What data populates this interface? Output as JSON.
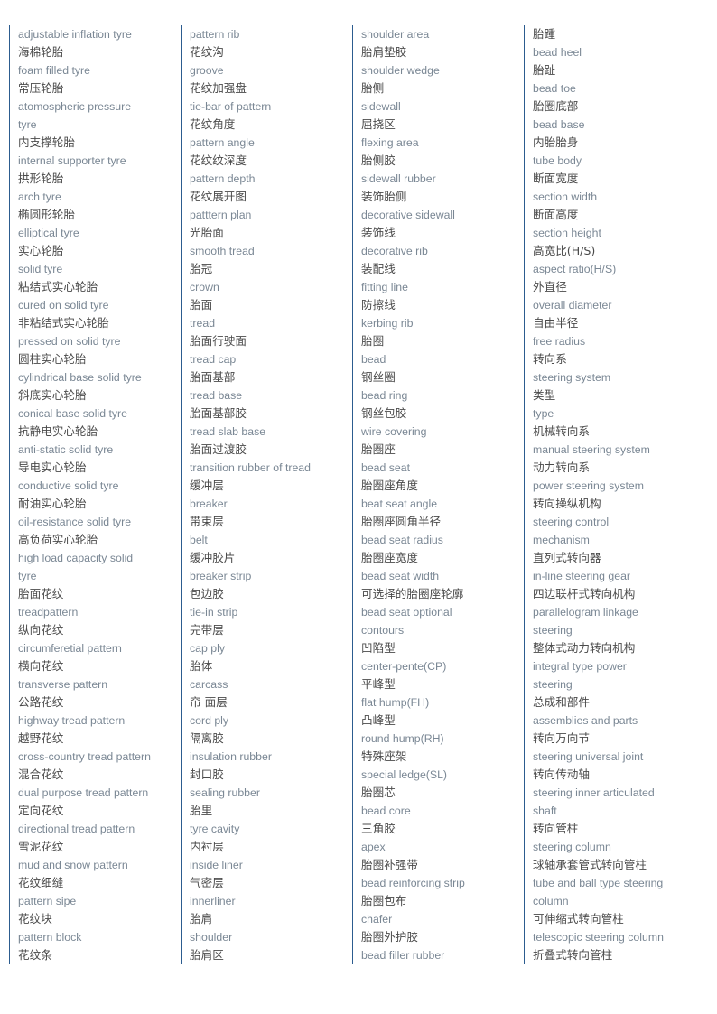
{
  "page": {
    "title": "Tyre and Steering System Bilingual Glossary",
    "background_color": "#ffffff",
    "column_rule_color": "#2c5c8f",
    "chinese_text_color": "#4a4a4a",
    "english_text_color": "#7a8794",
    "column_count": 4
  },
  "columns": [
    {
      "id": "column-1",
      "lines": [
        {
          "lang": "en",
          "text": "adjustable inflation tyre"
        },
        {
          "lang": "zh",
          "text": "海棉轮胎"
        },
        {
          "lang": "en",
          "text": "foam filled tyre"
        },
        {
          "lang": "zh",
          "text": "常压轮胎"
        },
        {
          "lang": "en",
          "text": "atomospheric pressure"
        },
        {
          "lang": "en",
          "text": "tyre"
        },
        {
          "lang": "zh",
          "text": "内支撑轮胎"
        },
        {
          "lang": "en",
          "text": "internal supporter tyre"
        },
        {
          "lang": "zh",
          "text": "拱形轮胎"
        },
        {
          "lang": "en",
          "text": "arch tyre"
        },
        {
          "lang": "zh",
          "text": "椭圆形轮胎"
        },
        {
          "lang": "en",
          "text": "elliptical tyre"
        },
        {
          "lang": "zh",
          "text": "实心轮胎"
        },
        {
          "lang": "en",
          "text": "solid tyre"
        },
        {
          "lang": "zh",
          "text": "粘结式实心轮胎"
        },
        {
          "lang": "en",
          "text": "cured on solid tyre"
        },
        {
          "lang": "zh",
          "text": "非粘结式实心轮胎"
        },
        {
          "lang": "en",
          "text": "pressed on solid tyre"
        },
        {
          "lang": "zh",
          "text": "圆柱实心轮胎"
        },
        {
          "lang": "en",
          "text": "cylindrical base solid tyre"
        },
        {
          "lang": "zh",
          "text": "斜底实心轮胎"
        },
        {
          "lang": "en",
          "text": "conical base solid tyre"
        },
        {
          "lang": "zh",
          "text": "抗静电实心轮胎"
        },
        {
          "lang": "en",
          "text": "anti-static solid tyre"
        },
        {
          "lang": "zh",
          "text": "导电实心轮胎"
        },
        {
          "lang": "en",
          "text": "conductive solid tyre"
        },
        {
          "lang": "zh",
          "text": "耐油实心轮胎"
        },
        {
          "lang": "en",
          "text": "oil-resistance solid tyre"
        },
        {
          "lang": "zh",
          "text": "高负荷实心轮胎"
        },
        {
          "lang": "en",
          "text": "high load capacity solid"
        },
        {
          "lang": "en",
          "text": "tyre"
        },
        {
          "lang": "zh",
          "text": "胎面花纹"
        },
        {
          "lang": "en",
          "text": "treadpattern"
        },
        {
          "lang": "zh",
          "text": "纵向花纹"
        },
        {
          "lang": "en",
          "text": "circumferetial pattern"
        },
        {
          "lang": "zh",
          "text": "横向花纹"
        },
        {
          "lang": "en",
          "text": "transverse pattern"
        },
        {
          "lang": "zh",
          "text": "公路花纹"
        },
        {
          "lang": "en",
          "text": "highway tread pattern"
        },
        {
          "lang": "zh",
          "text": "越野花纹"
        },
        {
          "lang": "en",
          "text": "cross-country tread pattern"
        },
        {
          "lang": "zh",
          "text": "混合花纹"
        },
        {
          "lang": "en",
          "text": "dual purpose tread pattern"
        },
        {
          "lang": "zh",
          "text": "定向花纹"
        },
        {
          "lang": "en",
          "text": "directional tread pattern"
        },
        {
          "lang": "zh",
          "text": "雪泥花纹"
        },
        {
          "lang": "en",
          "text": "mud and snow pattern"
        },
        {
          "lang": "zh",
          "text": "花纹细缝"
        },
        {
          "lang": "en",
          "text": "pattern sipe"
        },
        {
          "lang": "zh",
          "text": "花纹块"
        },
        {
          "lang": "en",
          "text": "pattern block"
        },
        {
          "lang": "zh",
          "text": "花纹条"
        }
      ]
    },
    {
      "id": "column-2",
      "lines": [
        {
          "lang": "en",
          "text": "pattern rib"
        },
        {
          "lang": "zh",
          "text": "花纹沟"
        },
        {
          "lang": "en",
          "text": "groove"
        },
        {
          "lang": "zh",
          "text": "花纹加强盘"
        },
        {
          "lang": "en",
          "text": "tie-bar of pattern"
        },
        {
          "lang": "zh",
          "text": "花纹角度"
        },
        {
          "lang": "en",
          "text": "pattern angle"
        },
        {
          "lang": "zh",
          "text": "花纹纹深度"
        },
        {
          "lang": "en",
          "text": "pattern depth"
        },
        {
          "lang": "zh",
          "text": "花纹展开图"
        },
        {
          "lang": "en",
          "text": "patttern plan"
        },
        {
          "lang": "zh",
          "text": "光胎面"
        },
        {
          "lang": "en",
          "text": "smooth tread"
        },
        {
          "lang": "zh",
          "text": "胎冠"
        },
        {
          "lang": "en",
          "text": "crown"
        },
        {
          "lang": "zh",
          "text": "胎面"
        },
        {
          "lang": "en",
          "text": "tread"
        },
        {
          "lang": "zh",
          "text": "胎面行驶面"
        },
        {
          "lang": "en",
          "text": "tread cap"
        },
        {
          "lang": "zh",
          "text": "胎面基部"
        },
        {
          "lang": "en",
          "text": "tread base"
        },
        {
          "lang": "zh",
          "text": "胎面基部胶"
        },
        {
          "lang": "en",
          "text": "tread slab base"
        },
        {
          "lang": "zh",
          "text": "胎面过渡胶"
        },
        {
          "lang": "en",
          "text": "transition rubber of tread"
        },
        {
          "lang": "zh",
          "text": "缓冲层"
        },
        {
          "lang": "en",
          "text": "breaker"
        },
        {
          "lang": "zh",
          "text": "带束层"
        },
        {
          "lang": "en",
          "text": "belt"
        },
        {
          "lang": "zh",
          "text": "缓冲胶片"
        },
        {
          "lang": "en",
          "text": "breaker strip"
        },
        {
          "lang": "zh",
          "text": "包边胶"
        },
        {
          "lang": "en",
          "text": "tie-in strip"
        },
        {
          "lang": "zh",
          "text": "完带层"
        },
        {
          "lang": "en",
          "text": "cap ply"
        },
        {
          "lang": "zh",
          "text": "胎体"
        },
        {
          "lang": "en",
          "text": "carcass"
        },
        {
          "lang": "zh",
          "text": "帘 面层"
        },
        {
          "lang": "en",
          "text": "cord ply"
        },
        {
          "lang": "zh",
          "text": "隔离胶"
        },
        {
          "lang": "en",
          "text": "insulation rubber"
        },
        {
          "lang": "zh",
          "text": "封口胶"
        },
        {
          "lang": "en",
          "text": "sealing rubber"
        },
        {
          "lang": "zh",
          "text": "胎里"
        },
        {
          "lang": "en",
          "text": "tyre cavity"
        },
        {
          "lang": "zh",
          "text": "内衬层"
        },
        {
          "lang": "en",
          "text": "inside liner"
        },
        {
          "lang": "zh",
          "text": "气密层"
        },
        {
          "lang": "en",
          "text": "innerliner"
        },
        {
          "lang": "zh",
          "text": "胎肩"
        },
        {
          "lang": "en",
          "text": "shoulder"
        },
        {
          "lang": "zh",
          "text": "胎肩区"
        }
      ]
    },
    {
      "id": "column-3",
      "lines": [
        {
          "lang": "en",
          "text": "shoulder area"
        },
        {
          "lang": "zh",
          "text": "胎肩垫胶"
        },
        {
          "lang": "en",
          "text": "shoulder wedge"
        },
        {
          "lang": "zh",
          "text": "胎侧"
        },
        {
          "lang": "en",
          "text": "sidewall"
        },
        {
          "lang": "zh",
          "text": "屈挠区"
        },
        {
          "lang": "en",
          "text": "flexing area"
        },
        {
          "lang": "zh",
          "text": "胎侧胶"
        },
        {
          "lang": "en",
          "text": "sidewall rubber"
        },
        {
          "lang": "zh",
          "text": "装饰胎侧"
        },
        {
          "lang": "en",
          "text": "decorative sidewall"
        },
        {
          "lang": "zh",
          "text": "装饰线"
        },
        {
          "lang": "en",
          "text": "decorative rib"
        },
        {
          "lang": "zh",
          "text": "装配线"
        },
        {
          "lang": "en",
          "text": "fitting line"
        },
        {
          "lang": "zh",
          "text": "防擦线"
        },
        {
          "lang": "en",
          "text": "kerbing rib"
        },
        {
          "lang": "zh",
          "text": "胎圈"
        },
        {
          "lang": "en",
          "text": "bead"
        },
        {
          "lang": "zh",
          "text": "钢丝圈"
        },
        {
          "lang": "en",
          "text": "bead ring"
        },
        {
          "lang": "zh",
          "text": "钢丝包胶"
        },
        {
          "lang": "en",
          "text": "wire covering"
        },
        {
          "lang": "zh",
          "text": "胎圈座"
        },
        {
          "lang": "en",
          "text": "bead seat"
        },
        {
          "lang": "zh",
          "text": "胎圈座角度"
        },
        {
          "lang": "en",
          "text": "beat seat angle"
        },
        {
          "lang": "zh",
          "text": "胎圈座圆角半径"
        },
        {
          "lang": "en",
          "text": "bead seat radius"
        },
        {
          "lang": "zh",
          "text": "胎圈座宽度"
        },
        {
          "lang": "en",
          "text": "bead seat width"
        },
        {
          "lang": "zh",
          "text": "可选择的胎圈座轮廓"
        },
        {
          "lang": "en",
          "text": "bead seat optional"
        },
        {
          "lang": "en",
          "text": "contours"
        },
        {
          "lang": "zh",
          "text": "凹陷型"
        },
        {
          "lang": "en",
          "text": "center-pente(CP)"
        },
        {
          "lang": "zh",
          "text": "平峰型"
        },
        {
          "lang": "en",
          "text": "flat hump(FH)"
        },
        {
          "lang": "zh",
          "text": "凸峰型"
        },
        {
          "lang": "en",
          "text": "round hump(RH)"
        },
        {
          "lang": "zh",
          "text": "特殊座架"
        },
        {
          "lang": "en",
          "text": "special ledge(SL)"
        },
        {
          "lang": "zh",
          "text": "胎圈芯"
        },
        {
          "lang": "en",
          "text": "bead core"
        },
        {
          "lang": "zh",
          "text": "三角胶"
        },
        {
          "lang": "en",
          "text": "apex"
        },
        {
          "lang": "zh",
          "text": "胎圈补强带"
        },
        {
          "lang": "en",
          "text": "bead reinforcing strip"
        },
        {
          "lang": "zh",
          "text": "胎圈包布"
        },
        {
          "lang": "en",
          "text": "chafer"
        },
        {
          "lang": "zh",
          "text": "胎圈外护胶"
        },
        {
          "lang": "en",
          "text": "bead filler rubber"
        }
      ]
    },
    {
      "id": "column-4",
      "lines": [
        {
          "lang": "zh",
          "text": "胎踵"
        },
        {
          "lang": "en",
          "text": "bead heel"
        },
        {
          "lang": "zh",
          "text": "胎趾"
        },
        {
          "lang": "en",
          "text": "bead toe"
        },
        {
          "lang": "zh",
          "text": "胎圈底部"
        },
        {
          "lang": "en",
          "text": "bead base"
        },
        {
          "lang": "zh",
          "text": "内胎胎身"
        },
        {
          "lang": "en",
          "text": "tube body"
        },
        {
          "lang": "zh",
          "text": "断面宽度"
        },
        {
          "lang": "en",
          "text": "section width"
        },
        {
          "lang": "zh",
          "text": "断面高度"
        },
        {
          "lang": "en",
          "text": "section height"
        },
        {
          "lang": "zh",
          "text": "高宽比(H/S)"
        },
        {
          "lang": "en",
          "text": "aspect ratio(H/S)"
        },
        {
          "lang": "zh",
          "text": "外直径"
        },
        {
          "lang": "en",
          "text": "overall diameter"
        },
        {
          "lang": "zh",
          "text": "自由半径"
        },
        {
          "lang": "en",
          "text": "free radius"
        },
        {
          "lang": "zh",
          "text": "转向系"
        },
        {
          "lang": "en",
          "text": "steering system"
        },
        {
          "lang": "zh",
          "text": "类型"
        },
        {
          "lang": "en",
          "text": "type"
        },
        {
          "lang": "zh",
          "text": "机械转向系"
        },
        {
          "lang": "en",
          "text": "manual steering system"
        },
        {
          "lang": "zh",
          "text": "动力转向系"
        },
        {
          "lang": "en",
          "text": "power steering system"
        },
        {
          "lang": "zh",
          "text": "转向操纵机构"
        },
        {
          "lang": "en",
          "text": "steering control"
        },
        {
          "lang": "en",
          "text": "mechanism"
        },
        {
          "lang": "zh",
          "text": "直列式转向器"
        },
        {
          "lang": "en",
          "text": "in-line steering gear"
        },
        {
          "lang": "zh",
          "text": "四边联杆式转向机构"
        },
        {
          "lang": "en",
          "text": "parallelogram linkage"
        },
        {
          "lang": "en",
          "text": "steering"
        },
        {
          "lang": "zh",
          "text": "整体式动力转向机构"
        },
        {
          "lang": "en",
          "text": "integral type power"
        },
        {
          "lang": "en",
          "text": "steering"
        },
        {
          "lang": "zh",
          "text": "总成和部件"
        },
        {
          "lang": "en",
          "text": "assemblies and parts"
        },
        {
          "lang": "zh",
          "text": "转向万向节"
        },
        {
          "lang": "en",
          "text": "steering universal joint"
        },
        {
          "lang": "zh",
          "text": "转向传动轴"
        },
        {
          "lang": "en",
          "text": "steering inner articulated"
        },
        {
          "lang": "en",
          "text": "shaft"
        },
        {
          "lang": "zh",
          "text": "转向管柱"
        },
        {
          "lang": "en",
          "text": "steering column"
        },
        {
          "lang": "zh",
          "text": "球轴承套管式转向管柱"
        },
        {
          "lang": "en",
          "text": "tube and ball type steering"
        },
        {
          "lang": "en",
          "text": "column"
        },
        {
          "lang": "zh",
          "text": "可伸缩式转向管柱"
        },
        {
          "lang": "en",
          "text": "telescopic steering column"
        },
        {
          "lang": "zh",
          "text": "折叠式转向管柱"
        }
      ]
    }
  ]
}
